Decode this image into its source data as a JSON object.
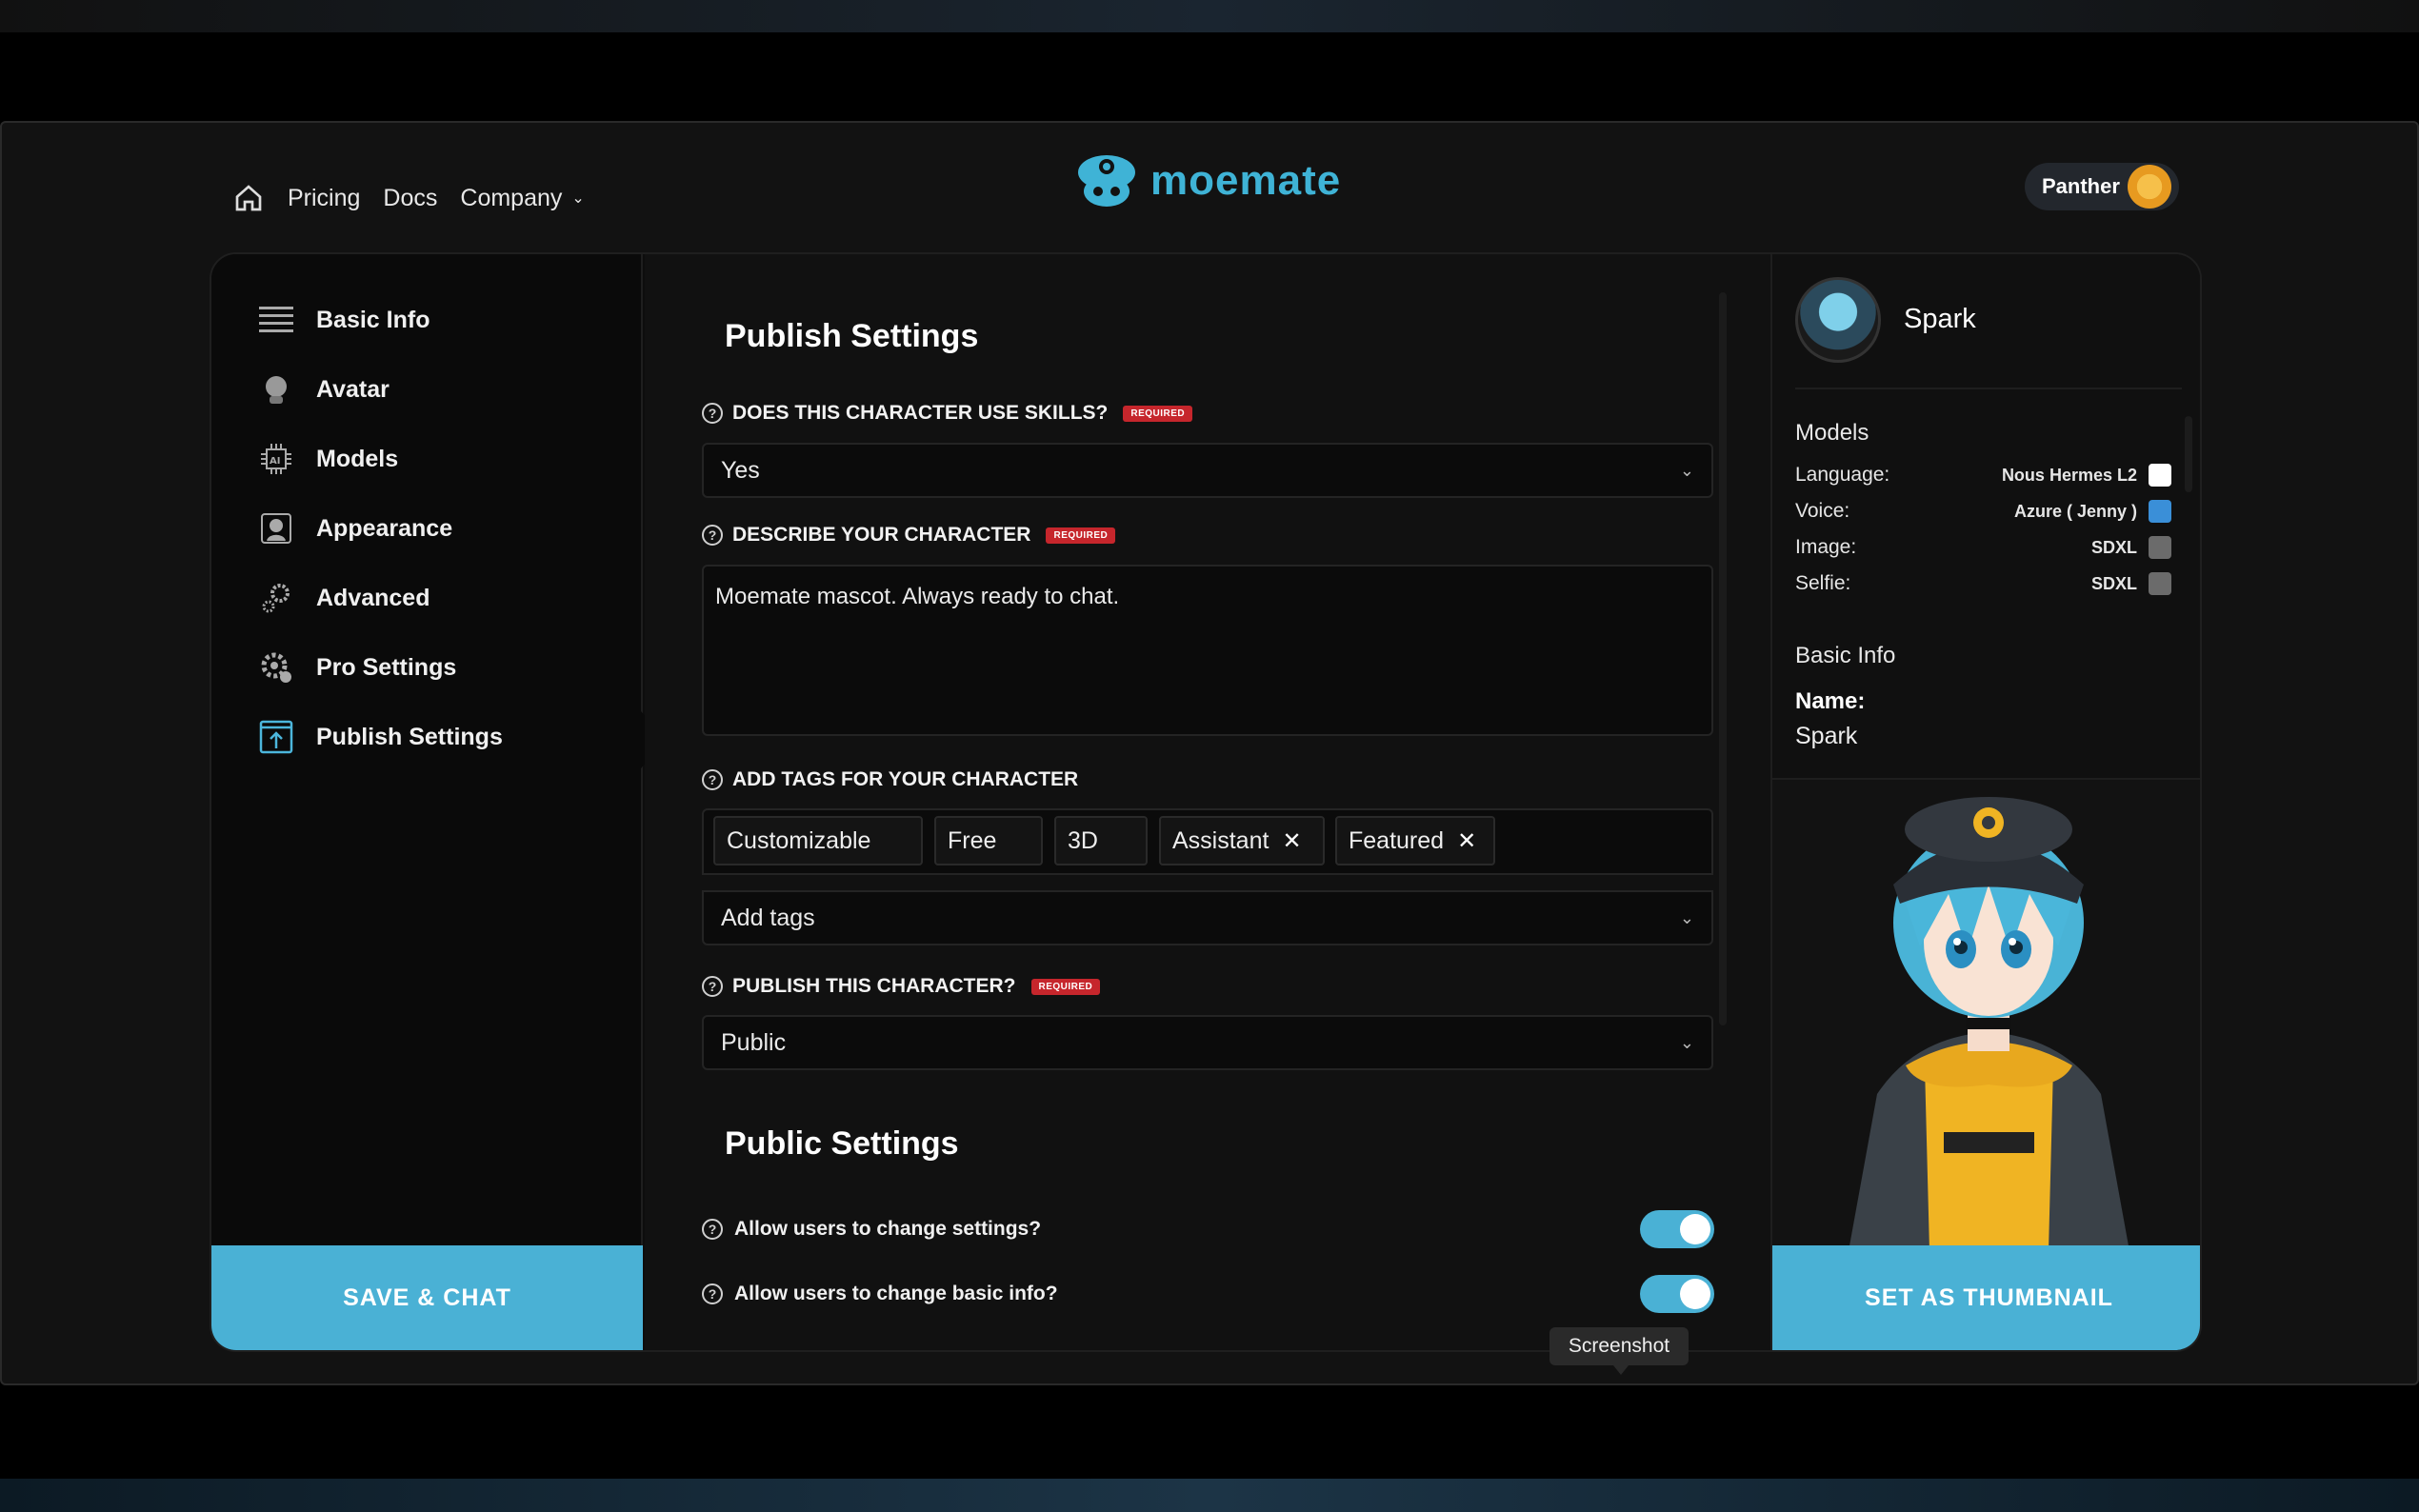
{
  "header": {
    "nav": [
      "Pricing",
      "Docs",
      "Company"
    ],
    "logo_text": "moemate",
    "user_name": "Panther"
  },
  "sidebar": {
    "items": [
      {
        "label": "Basic Info",
        "icon": "list-icon"
      },
      {
        "label": "Avatar",
        "icon": "avatar-icon"
      },
      {
        "label": "Models",
        "icon": "ai-chip-icon"
      },
      {
        "label": "Appearance",
        "icon": "portrait-icon"
      },
      {
        "label": "Advanced",
        "icon": "gears-icon"
      },
      {
        "label": "Pro Settings",
        "icon": "gear-cog-icon"
      },
      {
        "label": "Publish Settings",
        "icon": "upload-icon"
      }
    ],
    "save_label": "SAVE & CHAT"
  },
  "main": {
    "publish_title": "Publish Settings",
    "skills_label": "DOES THIS CHARACTER USE SKILLS?",
    "required": "REQUIRED",
    "skills_value": "Yes",
    "describe_label": "DESCRIBE YOUR CHARACTER",
    "describe_value": "Moemate mascot. Always ready to chat.",
    "tags_label": "ADD TAGS FOR YOUR CHARACTER",
    "tags": [
      "Customizable",
      "Free",
      "3D",
      "Assistant",
      "Featured"
    ],
    "add_tags_placeholder": "Add tags",
    "publish_label": "PUBLISH THIS CHARACTER?",
    "publish_value": "Public",
    "public_title": "Public Settings",
    "toggle_settings_label": "Allow users to change settings?",
    "toggle_basic_label": "Allow users to change basic info?"
  },
  "right": {
    "character_name": "Spark",
    "models_title": "Models",
    "models": [
      {
        "key": "Language:",
        "value": "Nous Hermes L2",
        "color": "#ffffff"
      },
      {
        "key": "Voice:",
        "value": "Azure ( Jenny )",
        "color": "#3a8fd8"
      },
      {
        "key": "Image:",
        "value": "SDXL",
        "color": "#6b6b6b"
      },
      {
        "key": "Selfie:",
        "value": "SDXL",
        "color": "#6b6b6b"
      }
    ],
    "basic_title": "Basic Info",
    "name_label": "Name:",
    "name_value": "Spark",
    "thumb_label": "SET AS THUMBNAIL"
  },
  "tooltip": "Screenshot",
  "colors": {
    "accent": "#4ab1d5",
    "required": "#c6262c",
    "logo": "#3fb3d6"
  }
}
